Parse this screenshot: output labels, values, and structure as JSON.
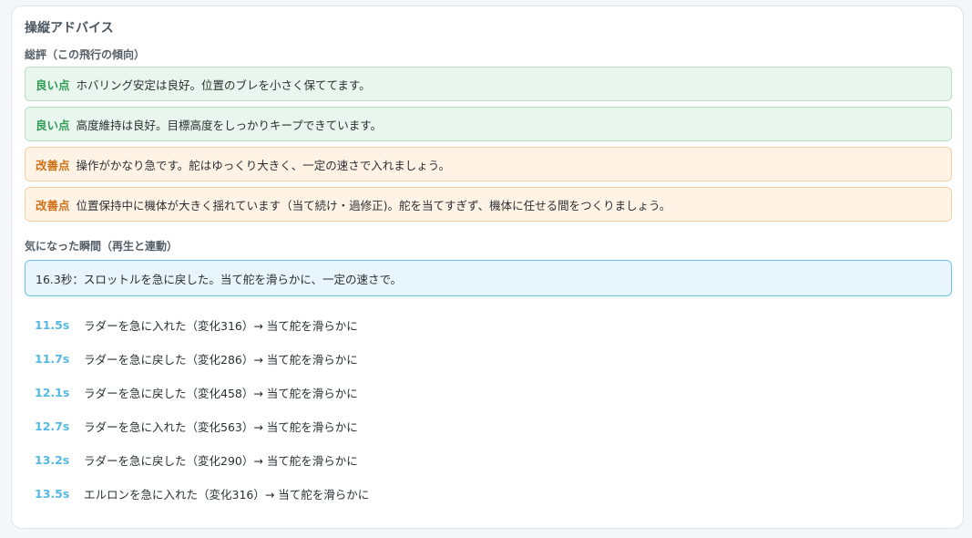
{
  "panel": {
    "title": "操縦アドバイス"
  },
  "summary": {
    "title": "総評（この飛行の傾向）",
    "items": [
      {
        "type": "good",
        "tag": "良い点",
        "text": "ホバリング安定は良好。位置のブレを小さく保ててます。"
      },
      {
        "type": "good",
        "tag": "良い点",
        "text": "高度維持は良好。目標高度をしっかりキープできています。"
      },
      {
        "type": "improve",
        "tag": "改善点",
        "text": "操作がかなり急です。舵はゆっくり大きく、一定の速さで入れましょう。"
      },
      {
        "type": "improve",
        "tag": "改善点",
        "text": "位置保持中に機体が大きく揺れています（当て続け・過修正)。舵を当てすぎず、機体に任せる間をつくりましょう。"
      }
    ]
  },
  "moments": {
    "title": "気になった瞬間（再生と連動）",
    "highlight": "16.3秒：スロットルを急に戻した。当て舵を滑らかに、一定の速さで。",
    "items": [
      {
        "time": "11.5s",
        "text": "ラダーを急に入れた（変化316）→ 当て舵を滑らかに"
      },
      {
        "time": "11.7s",
        "text": "ラダーを急に戻した（変化286）→ 当て舵を滑らかに"
      },
      {
        "time": "12.1s",
        "text": "ラダーを急に戻した（変化458）→ 当て舵を滑らかに"
      },
      {
        "time": "12.7s",
        "text": "ラダーを急に入れた（変化563）→ 当て舵を滑らかに"
      },
      {
        "time": "13.2s",
        "text": "ラダーを急に戻した（変化290）→ 当て舵を滑らかに"
      },
      {
        "time": "13.5s",
        "text": "エルロンを急に入れた（変化316）→ 当て舵を滑らかに"
      }
    ]
  }
}
